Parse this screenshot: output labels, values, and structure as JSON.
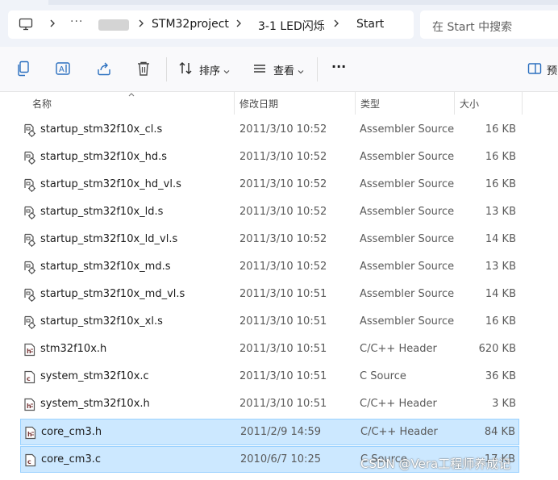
{
  "address_bar": {
    "overflow": "···",
    "crumbs": [
      "STM32project",
      "3-1 LED闪烁",
      "Start"
    ]
  },
  "search": {
    "placeholder": "在 Start 中搜索"
  },
  "toolbar": {
    "sort_label": "排序",
    "view_label": "查看",
    "more_label": "···",
    "preview_label": "预"
  },
  "columns": {
    "name": "名称",
    "date": "修改日期",
    "type": "类型",
    "size": "大小"
  },
  "files": [
    {
      "name": "startup_stm32f10x_cl.s",
      "date": "2011/3/10 10:52",
      "type": "Assembler Source",
      "size": "16 KB",
      "icon": "asm-file-icon"
    },
    {
      "name": "startup_stm32f10x_hd.s",
      "date": "2011/3/10 10:52",
      "type": "Assembler Source",
      "size": "16 KB",
      "icon": "asm-file-icon"
    },
    {
      "name": "startup_stm32f10x_hd_vl.s",
      "date": "2011/3/10 10:52",
      "type": "Assembler Source",
      "size": "16 KB",
      "icon": "asm-file-icon"
    },
    {
      "name": "startup_stm32f10x_ld.s",
      "date": "2011/3/10 10:52",
      "type": "Assembler Source",
      "size": "13 KB",
      "icon": "asm-file-icon"
    },
    {
      "name": "startup_stm32f10x_ld_vl.s",
      "date": "2011/3/10 10:52",
      "type": "Assembler Source",
      "size": "14 KB",
      "icon": "asm-file-icon"
    },
    {
      "name": "startup_stm32f10x_md.s",
      "date": "2011/3/10 10:52",
      "type": "Assembler Source",
      "size": "13 KB",
      "icon": "asm-file-icon"
    },
    {
      "name": "startup_stm32f10x_md_vl.s",
      "date": "2011/3/10 10:51",
      "type": "Assembler Source",
      "size": "14 KB",
      "icon": "asm-file-icon"
    },
    {
      "name": "startup_stm32f10x_xl.s",
      "date": "2011/3/10 10:51",
      "type": "Assembler Source",
      "size": "16 KB",
      "icon": "asm-file-icon"
    },
    {
      "name": "stm32f10x.h",
      "date": "2011/3/10 10:51",
      "type": "C/C++ Header",
      "size": "620 KB",
      "icon": "header-file-icon"
    },
    {
      "name": "system_stm32f10x.c",
      "date": "2011/3/10 10:51",
      "type": "C Source",
      "size": "36 KB",
      "icon": "c-file-icon"
    },
    {
      "name": "system_stm32f10x.h",
      "date": "2011/3/10 10:51",
      "type": "C/C++ Header",
      "size": "3 KB",
      "icon": "header-file-icon"
    },
    {
      "name": "core_cm3.h",
      "date": "2011/2/9 14:59",
      "type": "C/C++ Header",
      "size": "84 KB",
      "icon": "header-file-icon",
      "selected": true
    },
    {
      "name": "core_cm3.c",
      "date": "2010/6/7 10:25",
      "type": "C Source",
      "size": "17 KB",
      "icon": "c-file-icon",
      "selected": true
    }
  ],
  "watermark": "CSDN @Vera工程师养成记",
  "colors": {
    "selection_bg": "#cce8ff",
    "selection_border": "#99d1ff",
    "accent": "#0067c0"
  }
}
